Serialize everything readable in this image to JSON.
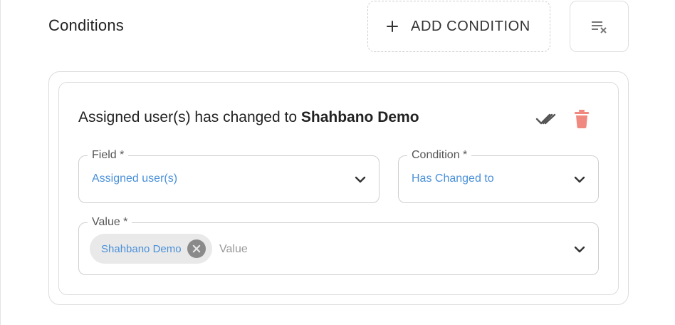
{
  "header": {
    "title": "Conditions",
    "add_condition_label": "ADD CONDITION",
    "clear_icon": "clear-all-icon"
  },
  "condition": {
    "summary_prefix": "Assigned user(s) has changed to",
    "summary_value": "Shahbano Demo",
    "actions": {
      "check_icon": "double-check-icon",
      "delete_icon": "trash-icon",
      "delete_color": "#f08a80"
    },
    "field": {
      "label": "Field *",
      "value": "Assigned user(s)"
    },
    "operator": {
      "label": "Condition *",
      "value": "Has Changed to"
    },
    "value_field": {
      "label": "Value *",
      "chips": [
        "Shahbano Demo"
      ],
      "placeholder": "Value"
    }
  },
  "colors": {
    "accent_text": "#4a90d9",
    "chip_bg": "#e9e9e9",
    "border": "#dcdcdc"
  }
}
